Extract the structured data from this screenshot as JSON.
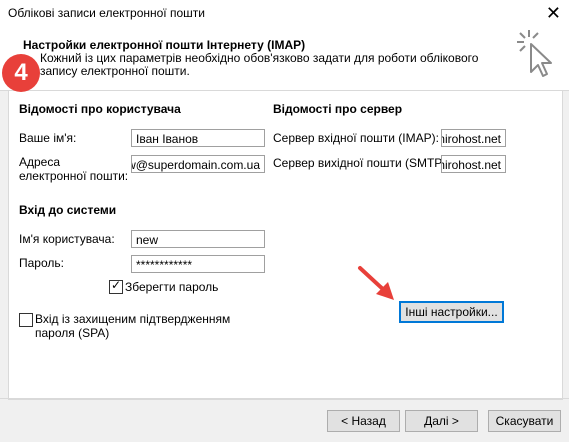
{
  "window": {
    "title": "Облікові записи електронної пошти"
  },
  "header": {
    "title": "Настройки електронної пошти Інтернету (IMAP)",
    "description": "Кожний із цих параметрів необхідно обов'язково задати для роботи облікового запису електронної пошти."
  },
  "step_badge": "4",
  "user_info": {
    "heading": "Відомості про користувача",
    "name_label": "Ваше ім'я:",
    "name_value": "Іван Іванов",
    "email_label": "Адреса електронної пошти:",
    "email_value": "new@superdomain.com.ua"
  },
  "server_info": {
    "heading": "Відомості про сервер",
    "incoming_label": "Сервер вхідної пошти (IMAP):",
    "incoming_value": "mirohost.net",
    "outgoing_label": "Сервер вихідної пошти (SMTP):",
    "outgoing_value": "mirohost.net"
  },
  "login": {
    "heading": "Вхід до системи",
    "username_label": "Ім'я користувача:",
    "username_value": "new",
    "password_label": "Пароль:",
    "password_value": "************",
    "remember_label": "Зберегти пароль",
    "remember_checked": true,
    "spa_label": "Вхід із захищеним підтвердженням пароля (SPA)",
    "spa_checked": false
  },
  "buttons": {
    "more_settings": "Інші настройки...",
    "back": "< Назад",
    "next": "Далі >",
    "cancel": "Скасувати"
  },
  "colors": {
    "badge": "#e8403a",
    "arrow": "#e8403a",
    "focus": "#0078d7"
  }
}
